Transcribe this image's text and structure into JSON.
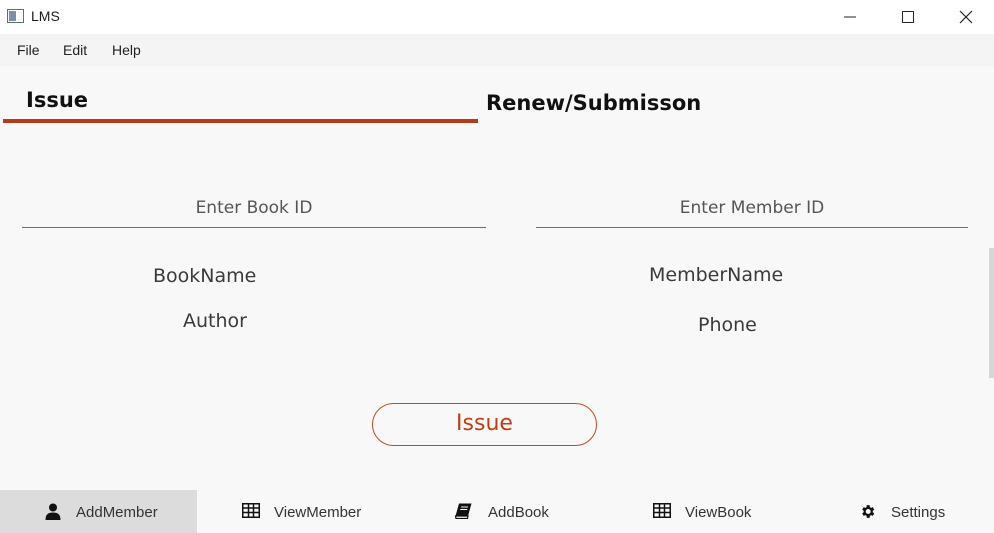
{
  "window": {
    "title": "LMS"
  },
  "menu": {
    "items": [
      "File",
      "Edit",
      "Help"
    ]
  },
  "tabs": [
    {
      "label": "Issue",
      "active": true
    },
    {
      "label": "Renew/Submisson",
      "active": false
    }
  ],
  "book": {
    "input_placeholder": "Enter Book ID",
    "input_value": "",
    "name_label": "BookName",
    "author_label": "Author"
  },
  "member": {
    "input_placeholder": "Enter Member ID",
    "input_value": "",
    "name_label": "MemberName",
    "phone_label": "Phone"
  },
  "action": {
    "issue_label": "Issue"
  },
  "bottom_nav": [
    {
      "label": "AddMember",
      "icon": "user-icon",
      "active": true
    },
    {
      "label": "ViewMember",
      "icon": "table-icon",
      "active": false
    },
    {
      "label": "AddBook",
      "icon": "book-icon",
      "active": false
    },
    {
      "label": "ViewBook",
      "icon": "table-icon",
      "active": false
    },
    {
      "label": "Settings",
      "icon": "gear-icon",
      "active": false
    }
  ],
  "colors": {
    "accent": "#b53a17",
    "active_nav": "#dcdcdc"
  }
}
